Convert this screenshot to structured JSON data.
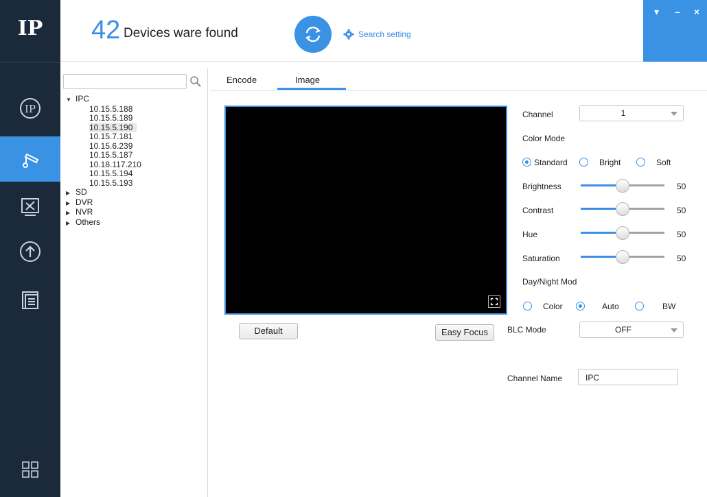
{
  "app": {
    "logo_text": "IP",
    "brand_color": "#3a92e5",
    "rail_color": "#1b2a3a"
  },
  "sidebar": {
    "items": [
      {
        "icon": "ip-circle-icon"
      },
      {
        "icon": "camera-settings-icon",
        "active": true
      },
      {
        "icon": "tools-icon"
      },
      {
        "icon": "upgrade-icon"
      },
      {
        "icon": "document-list-icon"
      },
      {
        "icon": "grid-apps-icon"
      }
    ]
  },
  "header": {
    "device_count": "42",
    "found_text": "Devices ware found",
    "search_setting_label": "Search setting",
    "window_buttons": {
      "menu": "▾",
      "minimize": "–",
      "close": "×"
    }
  },
  "tree": {
    "search_placeholder": "",
    "groups": [
      {
        "label": "IPC",
        "expanded": true,
        "children": [
          "10.15.5.188",
          "10.15.5.189",
          "10.15.5.190",
          "10.15.7.181",
          "10.15.6.239",
          "10.15.5.187",
          "10.18.117.210",
          "10.15.5.194",
          "10.15.5.193"
        ],
        "selected_index": 2
      },
      {
        "label": "SD",
        "expanded": false
      },
      {
        "label": "DVR",
        "expanded": false
      },
      {
        "label": "NVR",
        "expanded": false
      },
      {
        "label": "Others",
        "expanded": false
      }
    ]
  },
  "tabs": {
    "encode": "Encode",
    "image": "Image",
    "active": "Image"
  },
  "image": {
    "buttons": {
      "default": "Default",
      "easy_focus": "Easy Focus"
    },
    "channel": {
      "label": "Channel",
      "value": "1"
    },
    "color_mode": {
      "label": "Color Mode",
      "options": [
        "Standard",
        "Bright",
        "Soft"
      ],
      "selected": "Standard"
    },
    "sliders": {
      "brightness": {
        "label": "Brightness",
        "value": "50"
      },
      "contrast": {
        "label": "Contrast",
        "value": "50"
      },
      "hue": {
        "label": "Hue",
        "value": "50"
      },
      "saturation": {
        "label": "Saturation",
        "value": "50"
      }
    },
    "day_night": {
      "label": "Day/Night Mod",
      "options": [
        "Color",
        "Auto",
        "BW"
      ],
      "selected": "Auto"
    },
    "blc": {
      "label": "BLC Mode",
      "value": "OFF"
    },
    "channel_name": {
      "label": "Channel Name",
      "value": "IPC"
    }
  }
}
